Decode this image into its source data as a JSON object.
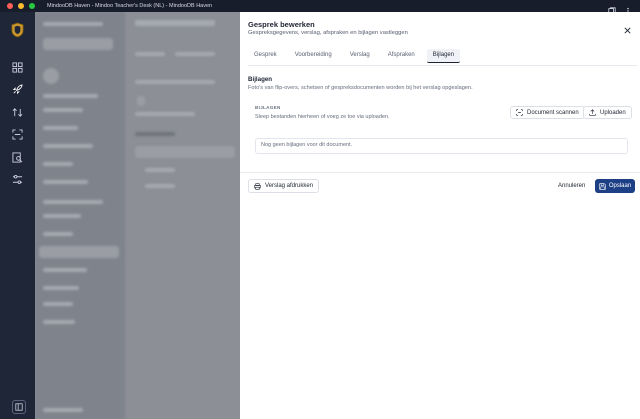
{
  "window": {
    "title": "MindooDB Haven - Mindoo Teacher's Desk (NL) - MindooDB Haven"
  },
  "rail": {
    "icons": [
      "app-logo",
      "dashboard-icon",
      "rocket-icon",
      "transfer-icon",
      "scan-icon",
      "search-document-icon",
      "settings-sliders-icon",
      "panel-toggle-icon"
    ]
  },
  "dialog": {
    "title": "Gesprek bewerken",
    "subtitle": "Gespreksgegevens, verslag, afspraken en bijlagen vastleggen",
    "tabs": [
      {
        "label": "Gesprek"
      },
      {
        "label": "Voorbereiding"
      },
      {
        "label": "Verslag"
      },
      {
        "label": "Afspraken"
      },
      {
        "label": "Bijlagen"
      }
    ],
    "active_tab": "Bijlagen",
    "section_title": "Bijlagen",
    "section_desc": "Foto's van flip-overs, schetsen of gespreksdocumenten worden bij het verslag opgeslagen.",
    "attachments": {
      "label": "BIJLAGEN",
      "hint": "Sleep bestanden hierheen of voeg ze toe via uploaden.",
      "scan_button": "Document scannen",
      "upload_button": "Uploaden",
      "empty_text": "Nog geen bijlagen voor dit document."
    },
    "footer": {
      "print_button": "Verslag afdrukken",
      "cancel_button": "Annuleren",
      "save_button": "Opslaan"
    }
  },
  "colors": {
    "primary": "#1d3f86",
    "rail": "#1e2638",
    "titlebar": "#171d2b"
  }
}
